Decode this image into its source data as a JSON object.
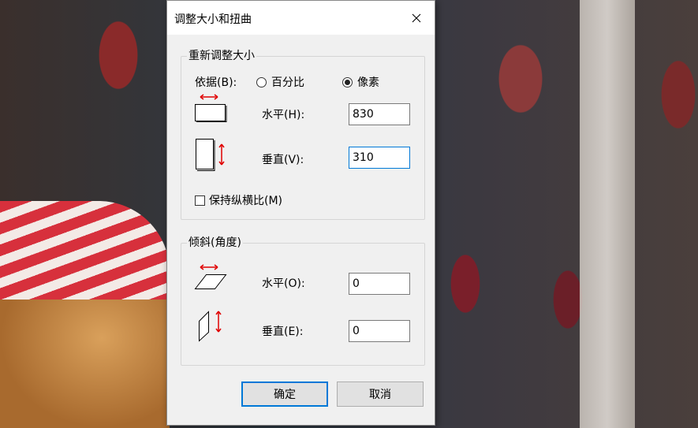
{
  "dialog": {
    "title": "调整大小和扭曲",
    "resize": {
      "legend": "重新调整大小",
      "basis_label": "依据(B):",
      "option_percent": "百分比",
      "option_pixels": "像素",
      "selected": "像素",
      "horizontal_label": "水平(H):",
      "horizontal_value": "830",
      "vertical_label": "垂直(V):",
      "vertical_value": "310",
      "keep_ratio_label": "保持纵横比(M)",
      "keep_ratio_checked": false
    },
    "skew": {
      "legend": "倾斜(角度)",
      "horizontal_label": "水平(O):",
      "horizontal_value": "0",
      "vertical_label": "垂直(E):",
      "vertical_value": "0"
    },
    "ok_label": "确定",
    "cancel_label": "取消"
  },
  "icons": {
    "close": "close-icon",
    "resize_horizontal": "resize-horizontal-icon",
    "resize_vertical": "resize-vertical-icon",
    "skew_horizontal": "skew-horizontal-icon",
    "skew_vertical": "skew-vertical-icon"
  },
  "colors": {
    "accent": "#0078d7",
    "arrow": "#e00000"
  }
}
